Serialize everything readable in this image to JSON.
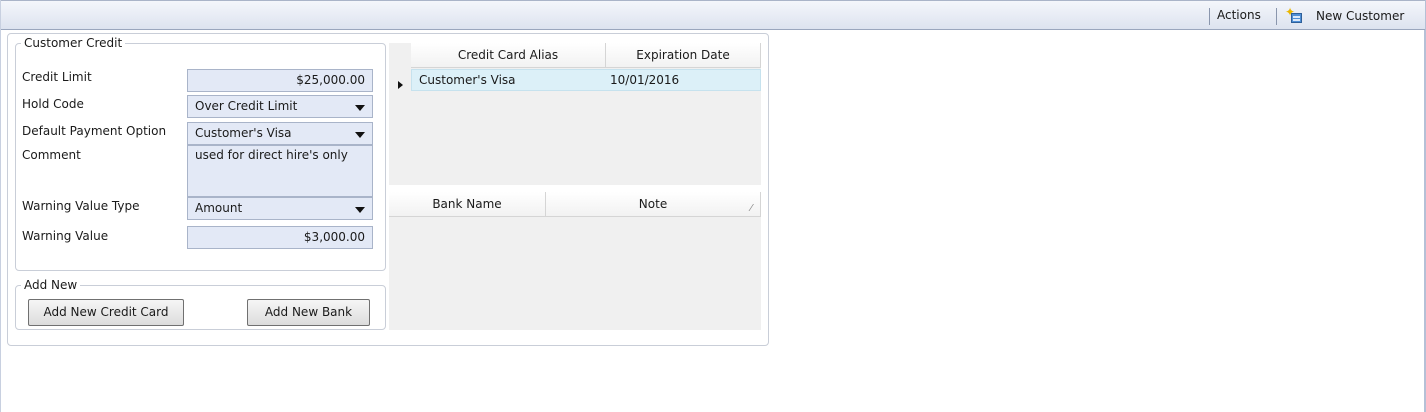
{
  "toolbar": {
    "actions_label": "Actions",
    "new_customer_label": "New Customer"
  },
  "customer_credit": {
    "legend": "Customer Credit",
    "credit_limit_label": "Credit Limit",
    "credit_limit_value": "$25,000.00",
    "hold_code_label": "Hold Code",
    "hold_code_value": "Over Credit Limit",
    "default_payment_label": "Default Payment Option",
    "default_payment_value": "Customer's Visa",
    "comment_label": "Comment",
    "comment_value": "used for direct hire's only",
    "warning_type_label": "Warning Value Type",
    "warning_type_value": "Amount",
    "warning_value_label": "Warning Value",
    "warning_value_value": "$3,000.00"
  },
  "add_new": {
    "legend": "Add New",
    "add_card_label": "Add New Credit Card",
    "add_bank_label": "Add New Bank"
  },
  "cards_grid": {
    "columns": [
      "Credit Card Alias",
      "Expiration Date"
    ],
    "rows": [
      [
        "Customer's Visa",
        "10/01/2016"
      ]
    ]
  },
  "banks_grid": {
    "columns": [
      "Bank Name",
      "Note"
    ],
    "rows": []
  }
}
